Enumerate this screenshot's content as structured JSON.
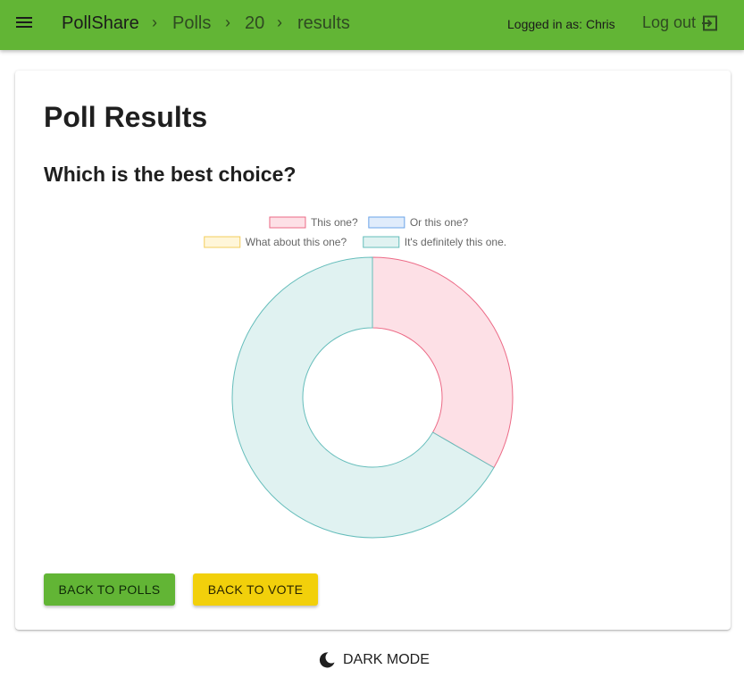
{
  "appbar": {
    "brand": "PollShare",
    "breadcrumbs": [
      "Polls",
      "20",
      "results"
    ],
    "separator": "›",
    "user_text": "Logged in as: Chris",
    "logout_label": "Log out",
    "color": "#62b535"
  },
  "card": {
    "title": "Poll Results",
    "question": "Which is the best choice?"
  },
  "chart_data": {
    "type": "doughnut",
    "legend_position": "top",
    "series": [
      {
        "name": "This one?",
        "value": 1,
        "fill": "#fde0e6",
        "stroke": "#ec6a86"
      },
      {
        "name": "Or this one?",
        "value": 0,
        "fill": "#e0ecfb",
        "stroke": "#6aa3e8"
      },
      {
        "name": "What about this one?",
        "value": 0,
        "fill": "#fff6d9",
        "stroke": "#f3cd5c"
      },
      {
        "name": "It's definitely this one.",
        "value": 2,
        "fill": "#e0f2f1",
        "stroke": "#65bdbb"
      }
    ]
  },
  "buttons": {
    "back_to_polls": "Back to polls",
    "back_to_vote": "Back to vote"
  },
  "footer": {
    "dark_mode_label": "Dark mode"
  }
}
